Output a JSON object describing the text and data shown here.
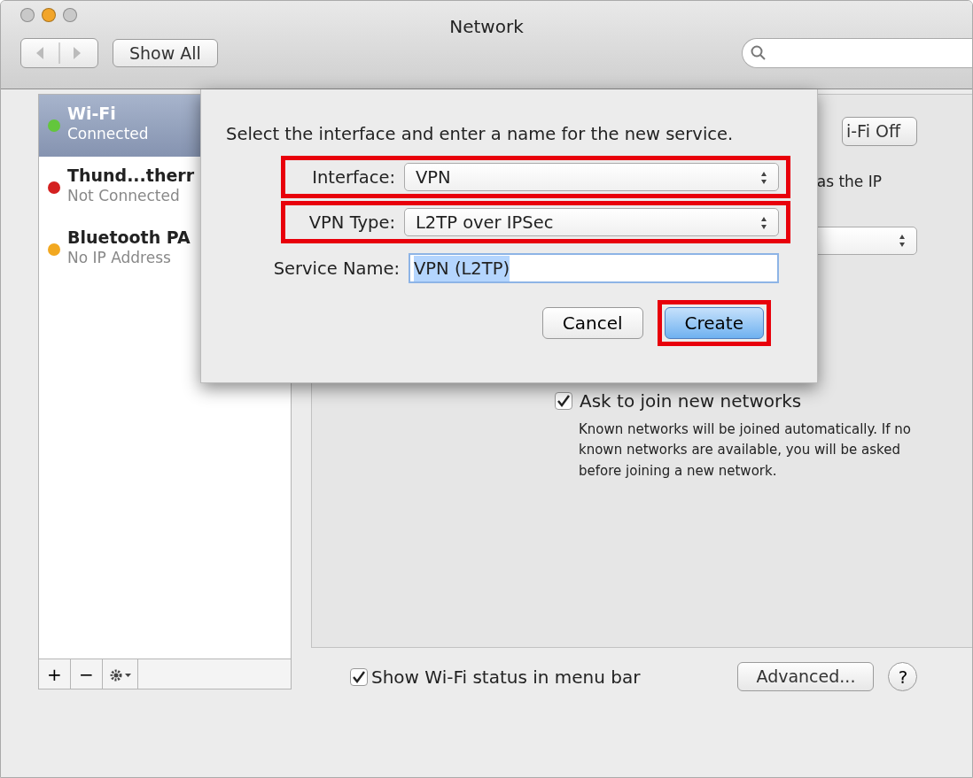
{
  "window": {
    "title": "Network",
    "traffic_lights": [
      {
        "color": "#c9c9c9"
      },
      {
        "color": "#f2a52a"
      },
      {
        "color": "#c9c9c9"
      }
    ]
  },
  "toolbar": {
    "show_all": "Show All"
  },
  "sidebar": {
    "items": [
      {
        "name": "Wi-Fi",
        "status": "Connected",
        "color": "#63c63c",
        "selected": true
      },
      {
        "name": "Thund...therr",
        "status": "Not Connected",
        "color": "#d42020",
        "selected": false
      },
      {
        "name": "Bluetooth PA",
        "status": "No IP Address",
        "color": "#f2a820",
        "selected": false
      }
    ],
    "footer_buttons": [
      "+",
      "−"
    ]
  },
  "panel": {
    "turn_off_button": "i-Fi Off",
    "status_text": "as the IP",
    "ask_to_join": {
      "label": "Ask to join new networks",
      "checked": true,
      "description": "Known networks will be joined automatically. If no known networks are available, you will be asked before joining a new network."
    },
    "show_status": {
      "label": "Show Wi-Fi status in menu bar",
      "checked": true
    },
    "advanced_button": "Advanced...",
    "help_button": "?"
  },
  "dialog": {
    "prompt": "Select the interface and enter a name for the new service.",
    "fields": [
      {
        "kind": "popup",
        "label": "Interface:",
        "value": "VPN",
        "highlighted": true
      },
      {
        "kind": "popup",
        "label": "VPN Type:",
        "value": "L2TP over IPSec",
        "highlighted": true
      },
      {
        "kind": "text",
        "label": "Service Name:",
        "value": "VPN (L2TP)",
        "highlighted": false
      }
    ],
    "buttons": [
      {
        "label": "Cancel",
        "default": false,
        "highlighted": false
      },
      {
        "label": "Create",
        "default": true,
        "highlighted": true
      }
    ]
  }
}
